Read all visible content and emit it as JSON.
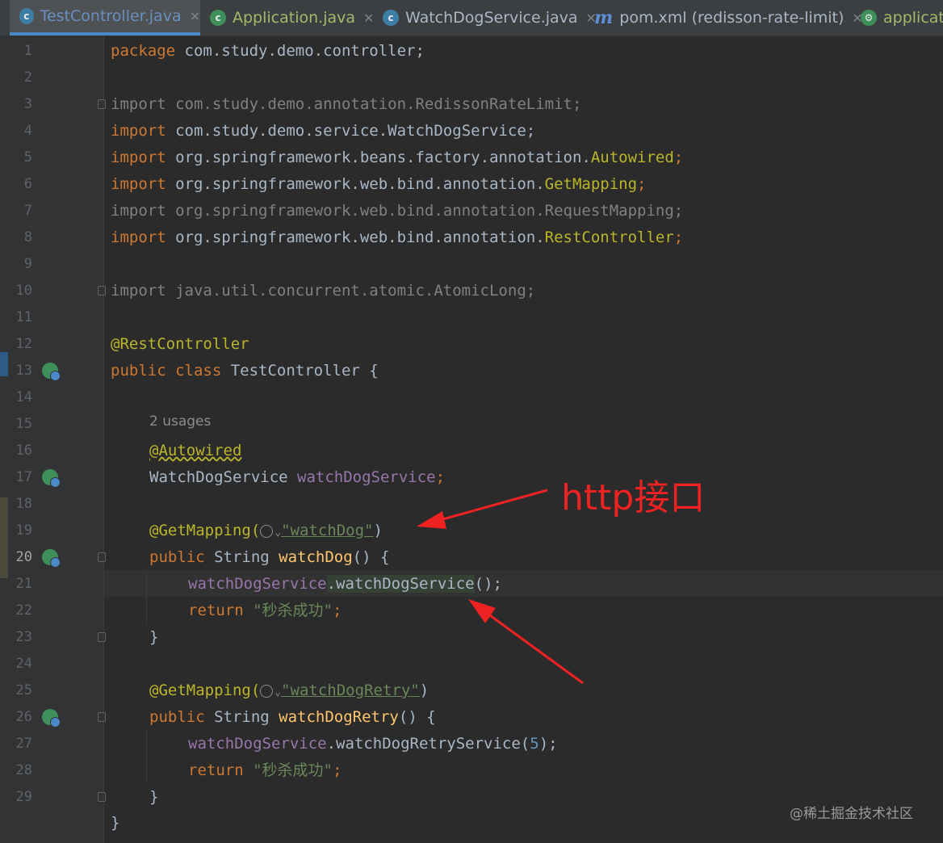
{
  "tabs": [
    {
      "label": "TestController.java",
      "icon": "class-c-icon",
      "active": true
    },
    {
      "label": "Application.java",
      "icon": "spring-class-icon",
      "active": false
    },
    {
      "label": "WatchDogService.java",
      "icon": "class-c-icon",
      "active": false
    },
    {
      "label": "pom.xml (redisson-rate-limit)",
      "icon": "maven-icon",
      "active": false
    },
    {
      "label": "applicati",
      "icon": "spring-config-icon",
      "active": false
    }
  ],
  "line_numbers": [
    "1",
    "2",
    "3",
    "4",
    "5",
    "6",
    "7",
    "8",
    "9",
    "10",
    "11",
    "12",
    "13",
    "14",
    "15",
    "16",
    "17",
    "18",
    "19",
    "20",
    "21",
    "22",
    "23",
    "24",
    "25",
    "26",
    "27",
    "28",
    "29"
  ],
  "current_line": "20",
  "code": {
    "l1": {
      "kw": "package",
      "rest": " com.study.demo.controller;"
    },
    "l3": "import com.study.demo.annotation.RedissonRateLimit;",
    "l4": {
      "kw": "import",
      "rest": " com.study.demo.service.WatchDogService;"
    },
    "l5": {
      "kw": "import",
      "pre": " org.springframework.beans.factory.annotation.",
      "an": "Autowired",
      "end": ";"
    },
    "l6": {
      "kw": "import",
      "pre": " org.springframework.web.bind.annotation.",
      "an": "GetMapping",
      "end": ";"
    },
    "l7": "import org.springframework.web.bind.annotation.RequestMapping;",
    "l8": {
      "kw": "import",
      "pre": " org.springframework.web.bind.annotation.",
      "an": "RestController",
      "end": ";"
    },
    "l10": "import java.util.concurrent.atomic.AtomicLong;",
    "l12": "@RestController",
    "l13": {
      "kw": "public class",
      "rest": " TestController {"
    },
    "usages": "2 usages",
    "l15": "@Autowired",
    "l16": {
      "type": "WatchDogService ",
      "field": "watchDogService",
      "end": ";"
    },
    "l18": {
      "an": "@GetMapping(",
      "str": "\"watchDog\"",
      "end": ")"
    },
    "l19": {
      "kw": "public ",
      "type": "String ",
      "method": "watchDog",
      "end": "() {"
    },
    "l20": {
      "field": "watchDogService",
      "call": ".watchDogService",
      "end": "();"
    },
    "l21": {
      "kw": "return ",
      "str": "\"秒杀成功\"",
      "end": ";"
    },
    "l22": "}",
    "l24": {
      "an": "@GetMapping(",
      "str": "\"watchDogRetry\"",
      "end": ")"
    },
    "l25": {
      "kw": "public ",
      "type": "String ",
      "method": "watchDogRetry",
      "end": "() {"
    },
    "l26": {
      "field": "watchDogService",
      "call": ".watchDogRetryService(",
      "num": "5",
      "end": ");"
    },
    "l27": {
      "kw": "return ",
      "str": "\"秒杀成功\"",
      "end": ";"
    },
    "l28": "}",
    "l29": "}"
  },
  "annotation": {
    "text": "http接口",
    "color": "#ee2222"
  },
  "watermark": "@稀土掘金技术社区",
  "colors": {
    "keyword": "#cc7832",
    "annotation": "#bbb529",
    "string": "#6a8759",
    "field": "#9876aa",
    "method": "#ffc66d",
    "number": "#6897bb",
    "text": "#a9b7c6",
    "background": "#2b2b2b"
  }
}
